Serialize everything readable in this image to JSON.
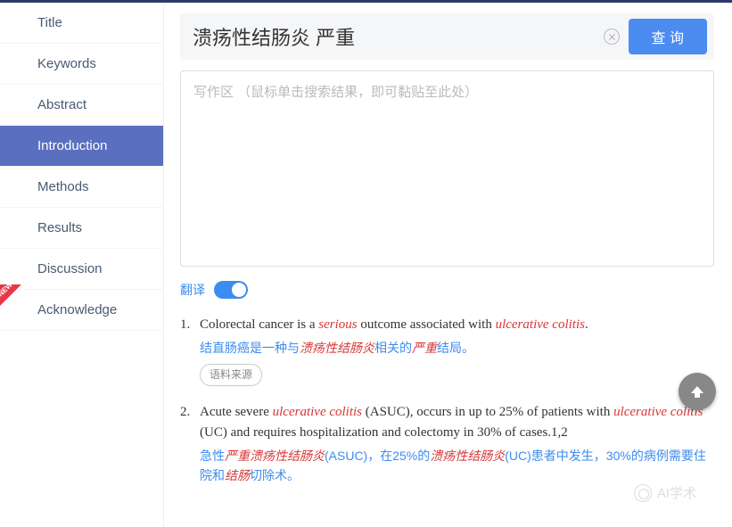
{
  "sidebar": {
    "items": [
      {
        "label": "Title"
      },
      {
        "label": "Keywords"
      },
      {
        "label": "Abstract"
      },
      {
        "label": "Introduction"
      },
      {
        "label": "Methods"
      },
      {
        "label": "Results"
      },
      {
        "label": "Discussion"
      },
      {
        "label": "Acknowledge"
      }
    ],
    "new_badge": "NEW"
  },
  "search": {
    "value": "溃疡性结肠炎 严重",
    "button": "查 询"
  },
  "writing": {
    "placeholder": "写作区 （鼠标单击搜索结果，即可黏贴至此处）"
  },
  "translate": {
    "label": "翻译"
  },
  "results": [
    {
      "num": "1.",
      "en_parts": [
        "Colorectal cancer is a ",
        "serious",
        " outcome associated with ",
        "ulcerative colitis",
        "."
      ],
      "zh_parts": [
        "结直肠癌是一种与",
        "溃疡性结肠炎",
        "相关的",
        "严重",
        "结局。"
      ],
      "source": "语料来源"
    },
    {
      "num": "2.",
      "en_parts": [
        "Acute severe ",
        "ulcerative colitis",
        " (ASUC), occurs in up to 25% of patients with ",
        "ulcerative colitis",
        " (UC) and requires hospitalization and colectomy in 30% of cases.1,2"
      ],
      "zh_parts": [
        "急性",
        "严重溃疡性结肠炎",
        "(ASUC)，在25%的",
        "溃疡性结肠炎",
        "(UC)患者中发生，30%的病例需要住院和",
        "结肠",
        "切除术。"
      ]
    }
  ],
  "watermark": "AI学术"
}
